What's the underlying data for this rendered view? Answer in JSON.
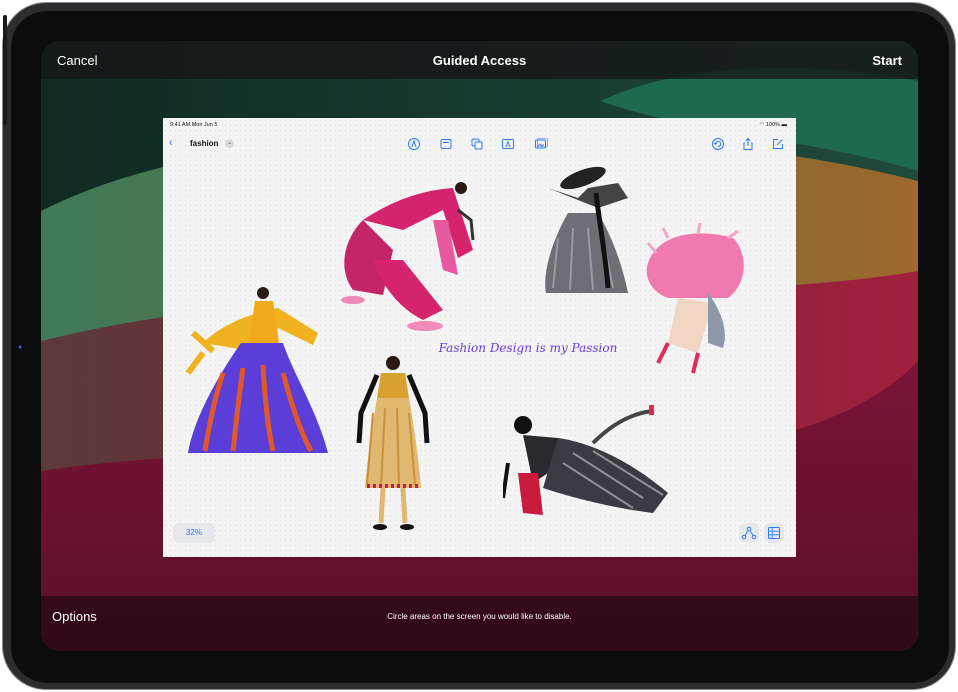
{
  "guided_access": {
    "top_bar": {
      "cancel_label": "Cancel",
      "title": "Guided Access",
      "start_label": "Start"
    },
    "bottom_bar": {
      "options_label": "Options",
      "hint": "Circle areas on the screen you would like to disable."
    }
  },
  "freeform_screenshot": {
    "status_bar": {
      "time": "9:41 AM  Mon Jun 5",
      "battery": "100%"
    },
    "toolbar": {
      "document_title": "fashion",
      "icons": [
        "back-chevron-icon",
        "pen-icon",
        "note-icon",
        "shapes-icon",
        "text-box-icon",
        "media-icon",
        "undo-icon",
        "share-icon",
        "compose-icon"
      ]
    },
    "canvas": {
      "caption": "Fashion Design is my Passion",
      "zoom_level": "32%"
    }
  },
  "colors": {
    "accent_blue": "#2a7bf5",
    "caption_purple": "#6a3fd6",
    "wallpaper_green": "#2f6b55",
    "wallpaper_magenta": "#7a1438"
  }
}
